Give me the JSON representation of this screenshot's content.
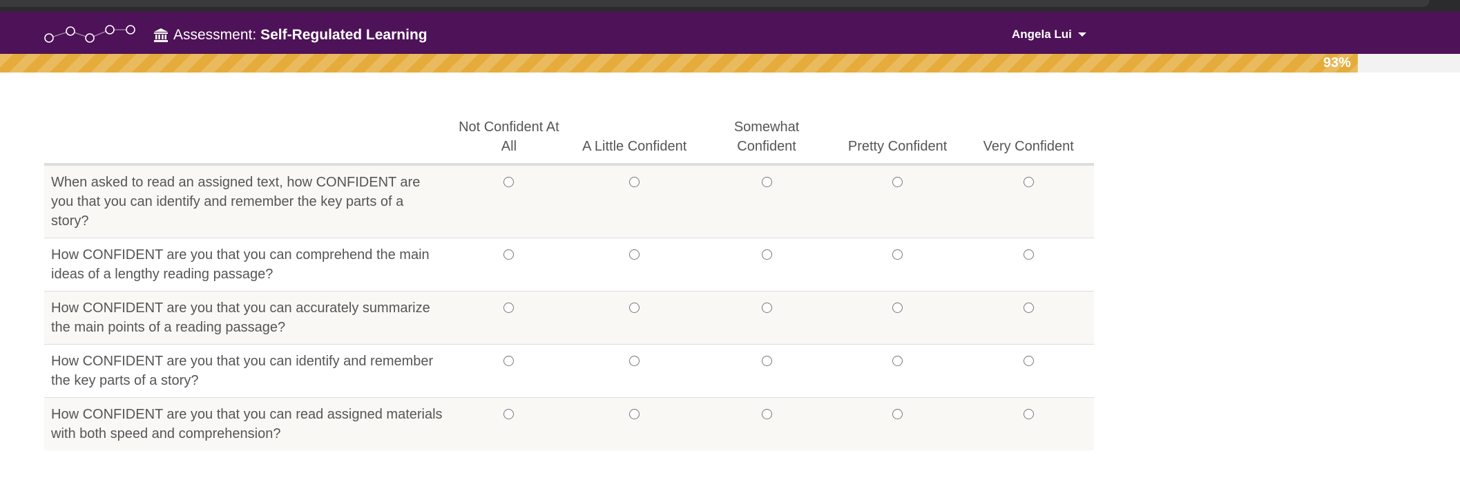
{
  "header": {
    "title_prefix": "Assessment:",
    "title_name": "Self-Regulated Learning",
    "user_name": "Angela Lui",
    "brand_color": "#4d1257"
  },
  "progress": {
    "value": 0.93,
    "label": "93%",
    "color": "#e5ac3b"
  },
  "survey": {
    "columns": [
      "Not Confident At All",
      "A Little Confident",
      "Somewhat Confident",
      "Pretty Confident",
      "Very Confident"
    ],
    "questions": [
      "When asked to read an assigned text, how CONFIDENT are you that you can identify and remember the key parts of a story?",
      "How CONFIDENT are you that you can comprehend the main ideas of a lengthy reading passage?",
      "How CONFIDENT are you that you can accurately summarize the main points of a reading passage?",
      "How CONFIDENT are you that you can identify and remember the key parts of a story?",
      "How CONFIDENT are you that you can read assigned materials with both speed and comprehension?"
    ]
  }
}
